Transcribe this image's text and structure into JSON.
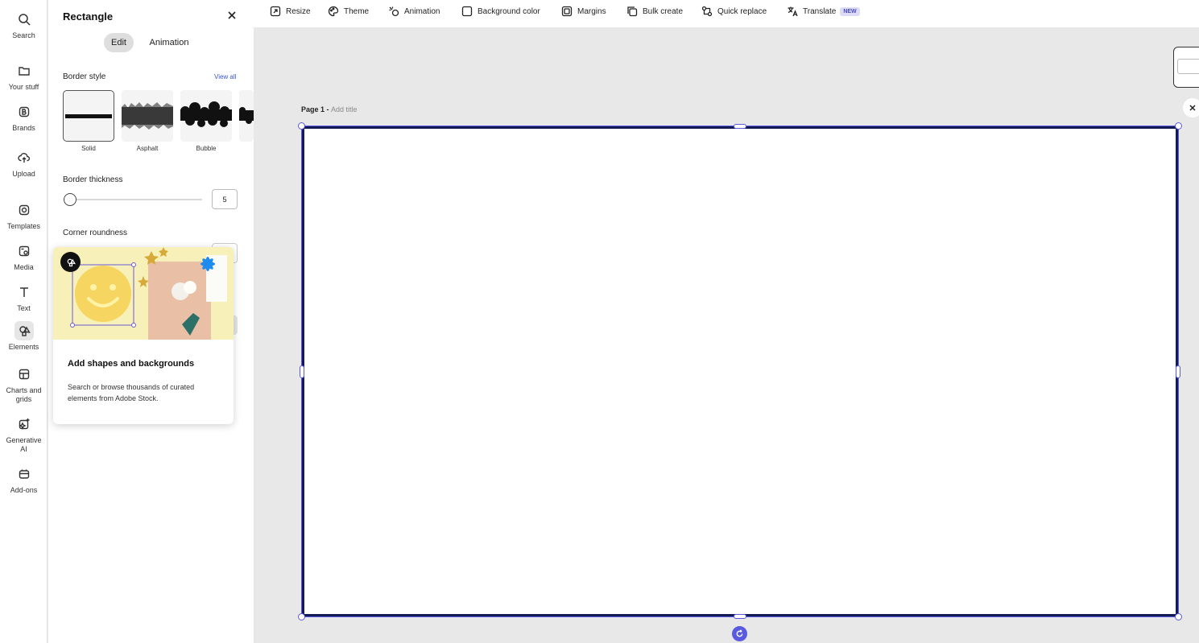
{
  "rail": {
    "items": [
      {
        "label": "Search",
        "icon": "search-icon"
      },
      {
        "label": "Your stuff",
        "icon": "folder-icon"
      },
      {
        "label": "Brands",
        "icon": "brand-icon"
      },
      {
        "label": "Upload",
        "icon": "upload-icon"
      },
      {
        "label": "Templates",
        "icon": "templates-icon"
      },
      {
        "label": "Media",
        "icon": "media-icon"
      },
      {
        "label": "Text",
        "icon": "text-icon"
      },
      {
        "label": "Elements",
        "icon": "elements-icon"
      },
      {
        "label": "Charts and grids",
        "icon": "charts-icon"
      },
      {
        "label": "Generative AI",
        "icon": "sparkle-icon"
      },
      {
        "label": "Add-ons",
        "icon": "addons-icon"
      }
    ],
    "active": "Elements"
  },
  "panel": {
    "title": "Rectangle",
    "tabs": {
      "edit": "Edit",
      "animation": "Animation"
    },
    "border_style": {
      "label": "Border style",
      "view_all": "View all",
      "options": [
        "Solid",
        "Asphalt",
        "Bubble"
      ]
    },
    "border_thickness": {
      "label": "Border thickness",
      "value": "5"
    },
    "corner_roundness": {
      "label": "Corner roundness"
    }
  },
  "popup": {
    "title": "Add shapes and backgrounds",
    "description": "Search or browse thousands of curated elements from Adobe Stock."
  },
  "toolbar": {
    "resize": "Resize",
    "theme": "Theme",
    "animation": "Animation",
    "background_color": "Background color",
    "margins": "Margins",
    "bulk_create": "Bulk create",
    "quick_replace": "Quick replace",
    "translate": "Translate",
    "translate_badge": "NEW"
  },
  "canvas": {
    "page_label": "Page 1 - ",
    "title_placeholder": "Add title"
  },
  "colors": {
    "accent": "#5a5ae0",
    "border": "#141b52"
  }
}
